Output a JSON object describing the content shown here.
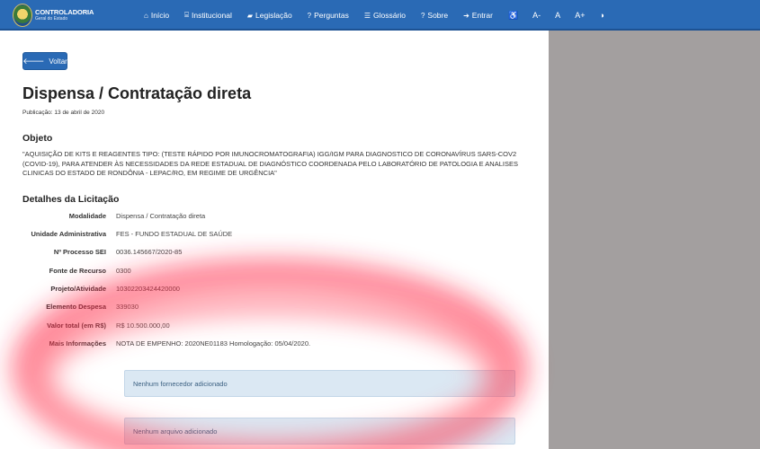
{
  "brand": {
    "title": "CONTROLADORIA",
    "subtitle": "Geral do Estado"
  },
  "nav": {
    "items": [
      {
        "icon": "home-icon",
        "glyph": "⌂",
        "label": "Início"
      },
      {
        "icon": "institution-icon",
        "glyph": "⌸",
        "label": "Institucional"
      },
      {
        "icon": "book-icon",
        "glyph": "▰",
        "label": "Legislação"
      },
      {
        "icon": "question-icon",
        "glyph": "?",
        "label": "Perguntas"
      },
      {
        "icon": "list-icon",
        "glyph": "☰",
        "label": "Glossário"
      },
      {
        "icon": "question-icon",
        "glyph": "?",
        "label": "Sobre"
      },
      {
        "icon": "sign-in-icon",
        "glyph": "➔",
        "label": "Entrar"
      }
    ],
    "accessibility": {
      "wheelchair": "♿",
      "decrease_font": "A-",
      "normal_font": "A",
      "increase_font": "A+",
      "contrast": "◑"
    }
  },
  "back_button": {
    "arrow": "🡐",
    "label": "Voltar"
  },
  "page": {
    "title": "Dispensa / Contratação direta",
    "publication": "Publicação: 13 de abril de 2020"
  },
  "objeto": {
    "heading": "Objeto",
    "text": "\"AQUISIÇÃO DE KITS E REAGENTES TIPO: (TESTE RÁPIDO POR IMUNOCROMATOGRAFIA) IGG/IGM PARA DIAGNOSTICO DE CORONAVÍRUS SARS-COV2 (COVID-19), PARA ATENDER ÀS NECESSIDADES DA REDE ESTADUAL DE DIAGNÓSTICO COORDENADA PELO LABORATÓRIO DE PATOLOGIA E ANALISES CLINICAS DO ESTADO DE RONDÔNIA - LEPAC/RO, EM REGIME DE URGÊNCIA\""
  },
  "details": {
    "heading": "Detalhes da Licitação",
    "rows": [
      {
        "label": "Modalidade",
        "value": "Dispensa / Contratação direta"
      },
      {
        "label": "Unidade Administrativa",
        "value": "FES - FUNDO ESTADUAL DE SAÚDE"
      },
      {
        "label": "Nº Processo SEI",
        "value": "0036.145667/2020-85"
      },
      {
        "label": "Fonte de Recurso",
        "value": "0300"
      },
      {
        "label": "Projeto/Atividade",
        "value": "10302203424420000"
      },
      {
        "label": "Elemento Despesa",
        "value": "339030"
      },
      {
        "label": "Valor total (em R$)",
        "value": "R$ 10.500.000,00"
      },
      {
        "label": "Mais Informações",
        "value": "NOTA DE EMPENHO: 2020NE01183 Homologação: 05/04/2020."
      }
    ]
  },
  "alerts": {
    "suppliers": "Nenhum fornecedor adicionado",
    "files": "Nenhum arquivo adicionado"
  }
}
